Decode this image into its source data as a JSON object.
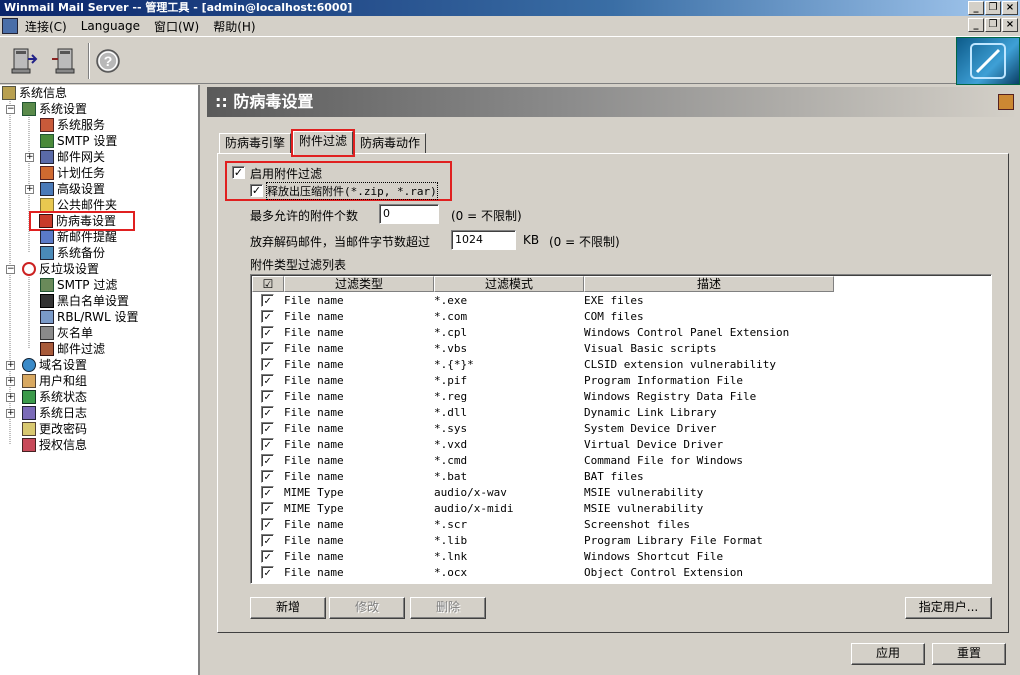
{
  "window": {
    "title": "Winmail Mail Server -- 管理工具 - [admin@localhost:6000]"
  },
  "menu": [
    "连接(C)",
    "Language",
    "窗口(W)",
    "帮助(H)"
  ],
  "tree": {
    "items": [
      {
        "label": "系统信息",
        "icon": "info-icon"
      },
      {
        "label": "系统设置",
        "icon": "settings-icon"
      },
      {
        "label": "系统服务",
        "icon": "service-icon"
      },
      {
        "label": "SMTP 设置",
        "icon": "smtp-icon"
      },
      {
        "label": "邮件网关",
        "icon": "gateway-icon"
      },
      {
        "label": "计划任务",
        "icon": "task-icon"
      },
      {
        "label": "高级设置",
        "icon": "advanced-icon"
      },
      {
        "label": "公共邮件夹",
        "icon": "folder-icon"
      },
      {
        "label": "防病毒设置",
        "icon": "antivirus-icon"
      },
      {
        "label": "新邮件提醒",
        "icon": "new-mail-icon"
      },
      {
        "label": "系统备份",
        "icon": "backup-icon"
      },
      {
        "label": "反垃圾设置",
        "icon": "antispam-icon"
      },
      {
        "label": "SMTP 过滤",
        "icon": "filter-icon"
      },
      {
        "label": "黑白名单设置",
        "icon": "list-icon"
      },
      {
        "label": "RBL/RWL 设置",
        "icon": "rbl-icon"
      },
      {
        "label": "灰名单",
        "icon": "greylist-icon"
      },
      {
        "label": "邮件过滤",
        "icon": "mail-filter-icon"
      },
      {
        "label": "域名设置",
        "icon": "domain-icon"
      },
      {
        "label": "用户和组",
        "icon": "users-icon"
      },
      {
        "label": "系统状态",
        "icon": "status-icon"
      },
      {
        "label": "系统日志",
        "icon": "log-icon"
      },
      {
        "label": "更改密码",
        "icon": "password-icon"
      },
      {
        "label": "授权信息",
        "icon": "license-icon"
      }
    ]
  },
  "panel": {
    "title": ":: 防病毒设置"
  },
  "tabs": [
    "防病毒引擎",
    "附件过滤",
    "防病毒动作"
  ],
  "form": {
    "enable_filter": "启用附件过滤",
    "release_archives": "释放出压缩附件(*.zip, *.rar)",
    "max_attachments_label": "最多允许的附件个数",
    "max_attachments_value": "0",
    "max_attachments_hint": "(0 = 不限制)",
    "skip_decode_label": "放弃解码邮件，当邮件字节数超过",
    "skip_decode_value": "1024",
    "skip_decode_unit": "KB",
    "skip_decode_hint": "(0 = 不限制)",
    "list_label": "附件类型过滤列表"
  },
  "list": {
    "headers": [
      "过滤类型",
      "过滤模式",
      "描述"
    ],
    "rows": [
      [
        "File name",
        "*.exe",
        "EXE files"
      ],
      [
        "File name",
        "*.com",
        "COM files"
      ],
      [
        "File name",
        "*.cpl",
        "Windows Control Panel Extension"
      ],
      [
        "File name",
        "*.vbs",
        "Visual Basic scripts"
      ],
      [
        "File name",
        "*.{*}*",
        "CLSID extension vulnerability"
      ],
      [
        "File name",
        "*.pif",
        "Program Information File"
      ],
      [
        "File name",
        "*.reg",
        "Windows Registry Data File"
      ],
      [
        "File name",
        "*.dll",
        "Dynamic Link Library"
      ],
      [
        "File name",
        "*.sys",
        "System Device Driver"
      ],
      [
        "File name",
        "*.vxd",
        "Virtual Device Driver"
      ],
      [
        "File name",
        "*.cmd",
        "Command File for Windows"
      ],
      [
        "File name",
        "*.bat",
        "BAT files"
      ],
      [
        "MIME Type",
        "audio/x-wav",
        "MSIE vulnerability"
      ],
      [
        "MIME Type",
        "audio/x-midi",
        "MSIE vulnerability"
      ],
      [
        "File name",
        "*.scr",
        "Screenshot files"
      ],
      [
        "File name",
        "*.lib",
        "Program Library File Format"
      ],
      [
        "File name",
        "*.lnk",
        "Windows Shortcut File"
      ],
      [
        "File name",
        "*.ocx",
        "Object Control Extension"
      ]
    ]
  },
  "buttons": {
    "add": "新增",
    "edit": "修改",
    "delete": "删除",
    "assign_users": "指定用户...",
    "apply": "应用",
    "reset": "重置"
  }
}
